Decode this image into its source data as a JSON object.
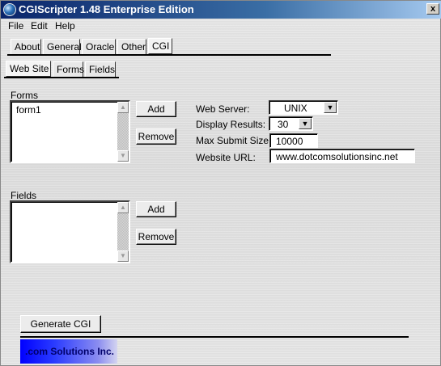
{
  "window": {
    "title": "CGIScripter 1.48 Enterprise Edition",
    "close_glyph": "x"
  },
  "menu": [
    {
      "label": "File"
    },
    {
      "label": "Edit"
    },
    {
      "label": "Help"
    }
  ],
  "main_tabs": [
    {
      "label": "About"
    },
    {
      "label": "General"
    },
    {
      "label": "Oracle"
    },
    {
      "label": "Other"
    },
    {
      "label": "CGI",
      "selected": true
    }
  ],
  "sub_tabs": [
    {
      "label": "Web Site",
      "selected": true
    },
    {
      "label": "Forms"
    },
    {
      "label": "Fields"
    }
  ],
  "forms": {
    "label": "Forms",
    "items": [
      "form1"
    ],
    "add_label": "Add",
    "remove_label": "Remove"
  },
  "fields": {
    "label": "Fields",
    "items": [],
    "add_label": "Add",
    "remove_label": "Remove"
  },
  "settings": {
    "web_server_label": "Web Server:",
    "web_server_value": "UNIX",
    "display_results_label": "Display Results:",
    "display_results_value": "30",
    "max_submit_label": "Max Submit Size:",
    "max_submit_value": "10000",
    "website_url_label": "Website URL:",
    "website_url_value": "www.dotcomsolutionsinc.net"
  },
  "actions": {
    "generate_label": "Generate CGI"
  },
  "footer": {
    "logo_text": ".com Solutions Inc."
  },
  "icons": {
    "scroll_up": "▲",
    "scroll_down": "▼",
    "dropdown": "▼"
  },
  "colors": {
    "titlebar_start": "#0a246a",
    "titlebar_end": "#a6caf0",
    "logo_blue": "#0000ff"
  }
}
